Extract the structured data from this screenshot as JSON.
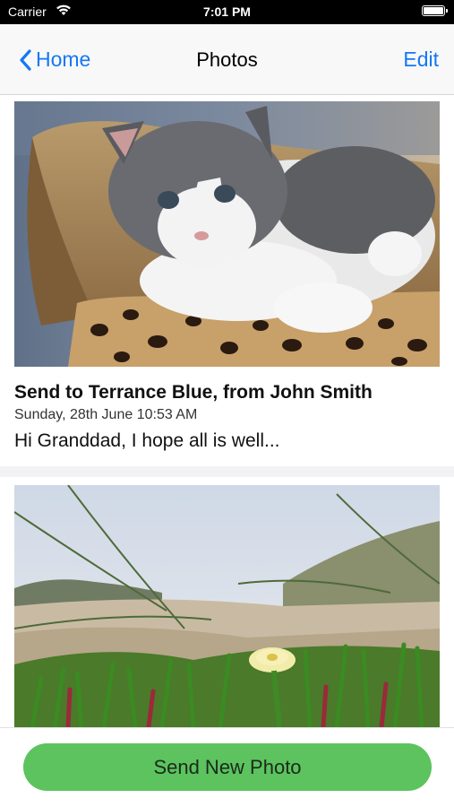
{
  "status_bar": {
    "carrier": "Carrier",
    "time": "7:01 PM",
    "icons": [
      "wifi-icon",
      "battery-icon"
    ]
  },
  "nav": {
    "back_label": "Home",
    "title": "Photos",
    "edit_label": "Edit",
    "accent_color": "#1478f5"
  },
  "posts": [
    {
      "image": "kitten-photo",
      "title": "Send to Terrance Blue, from John Smith",
      "date": "Sunday, 28th June 10:53 AM",
      "message": "Hi Granddad, I hope all is well..."
    },
    {
      "image": "beach-grass-flower-photo"
    }
  ],
  "footer": {
    "send_label": "Send New Photo",
    "button_color": "#5cc35e"
  }
}
